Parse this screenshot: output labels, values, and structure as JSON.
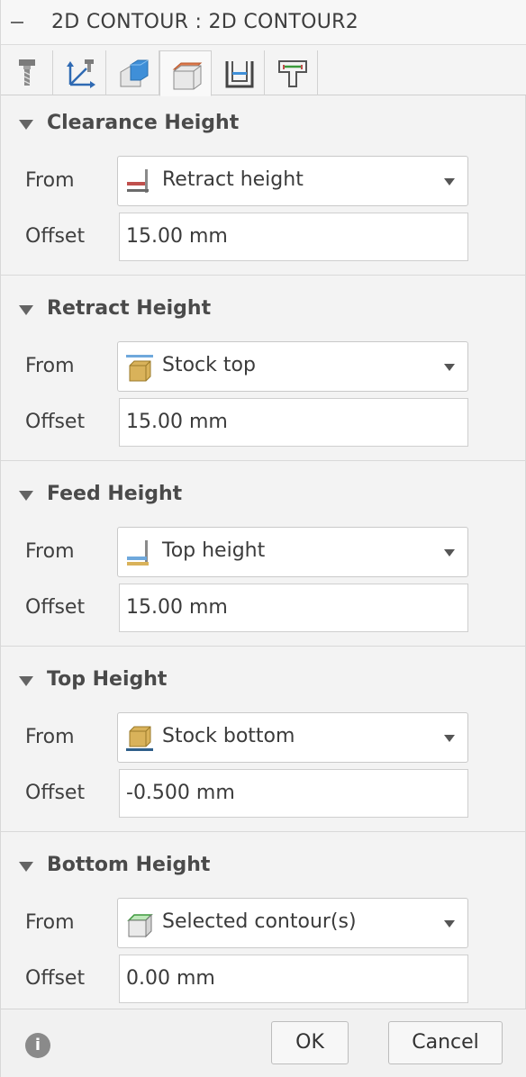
{
  "header": {
    "title": "2D CONTOUR : 2D CONTOUR2"
  },
  "tabs": [
    {
      "icon": "tool-icon"
    },
    {
      "icon": "axes-icon"
    },
    {
      "icon": "geometry-icon"
    },
    {
      "icon": "heights-icon",
      "active": true
    },
    {
      "icon": "passes-icon"
    },
    {
      "icon": "linking-icon"
    }
  ],
  "sections": {
    "clearance": {
      "title": "Clearance Height",
      "from_label": "From",
      "from_value": "Retract height",
      "from_icon": "retract-height-icon",
      "offset_label": "Offset",
      "offset_value": "15.00 mm"
    },
    "retract": {
      "title": "Retract Height",
      "from_label": "From",
      "from_value": "Stock top",
      "from_icon": "stock-top-icon",
      "offset_label": "Offset",
      "offset_value": "15.00 mm"
    },
    "feed": {
      "title": "Feed Height",
      "from_label": "From",
      "from_value": "Top height",
      "from_icon": "top-height-icon",
      "offset_label": "Offset",
      "offset_value": "15.00 mm"
    },
    "top": {
      "title": "Top Height",
      "from_label": "From",
      "from_value": "Stock bottom",
      "from_icon": "stock-bottom-icon",
      "offset_label": "Offset",
      "offset_value": "-0.500 mm"
    },
    "bottom": {
      "title": "Bottom Height",
      "from_label": "From",
      "from_value": "Selected contour(s)",
      "from_icon": "selected-contour-icon",
      "offset_label": "Offset",
      "offset_value": "0.00 mm"
    }
  },
  "footer": {
    "info": "i",
    "ok_label": "OK",
    "cancel_label": "Cancel"
  },
  "colors": {
    "retract_red": "#c0504d",
    "stock_tan": "#d9b25a",
    "top_blue": "#6fa8dc",
    "bottom_navy": "#2f5f8a",
    "contour_green": "#8fd18b"
  }
}
